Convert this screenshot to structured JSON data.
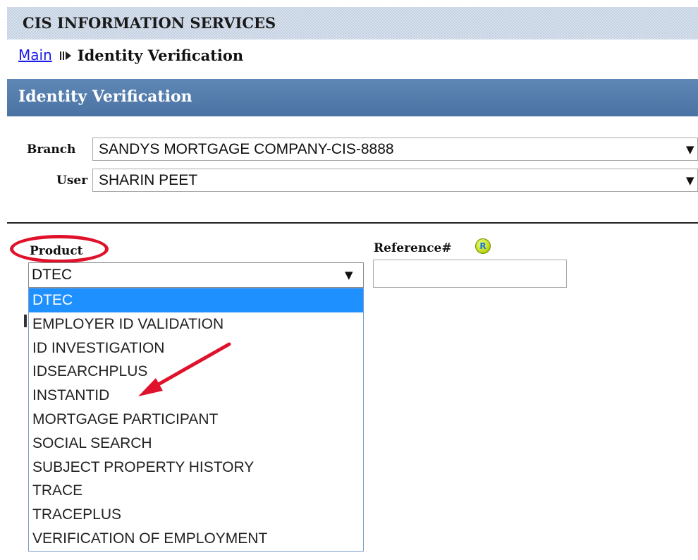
{
  "app": {
    "title": "CIS INFORMATION SERVICES"
  },
  "breadcrumb": {
    "main_link": "Main",
    "current": "Identity Verification"
  },
  "section": {
    "title": "Identity Verification"
  },
  "branch": {
    "label": "Branch",
    "value": "SANDYS MORTGAGE COMPANY-CIS-8888"
  },
  "user": {
    "label": "User",
    "value": "SHARIN PEET"
  },
  "product": {
    "label": "Product",
    "value": "DTEC",
    "options": [
      "DTEC",
      "EMPLOYER ID VALIDATION",
      "ID INVESTIGATION",
      "IDSEARCHPLUS",
      "INSTANTID",
      "MORTGAGE PARTICIPANT",
      "SOCIAL SEARCH",
      "SUBJECT PROPERTY HISTORY",
      "TRACE",
      "TRACEPLUS",
      "VERIFICATION OF EMPLOYMENT"
    ],
    "selected_option": "DTEC"
  },
  "reference": {
    "label": "Reference#",
    "value": "",
    "help_icon_letter": "R"
  },
  "icons": {
    "dropdown_arrow": "▼",
    "breadcrumb_separator": "play-bar-icon"
  },
  "colors": {
    "annotation": "#e0112b",
    "selection": "#1e90ff",
    "header": "#5179aa"
  }
}
